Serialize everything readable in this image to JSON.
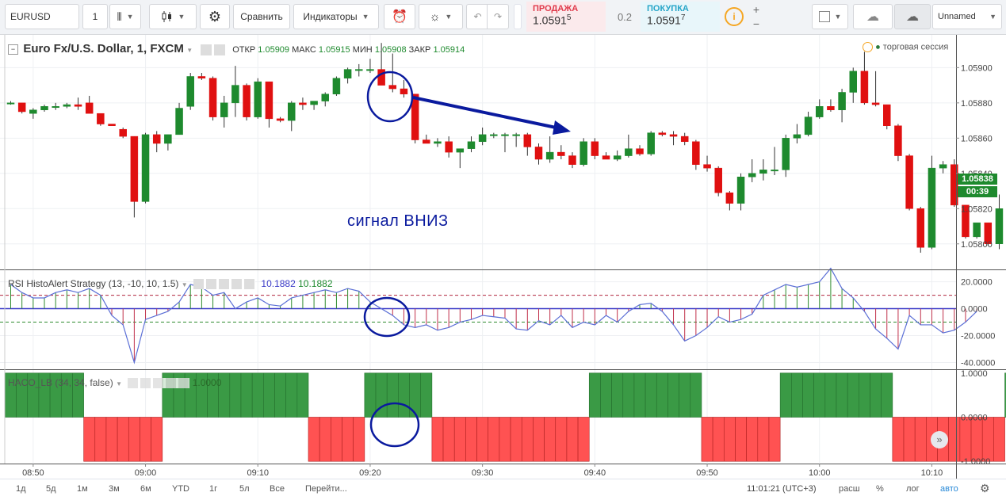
{
  "toolbar": {
    "symbol": "EURUSD",
    "interval": "1",
    "compare_label": "Сравнить",
    "indicators_label": "Индикаторы",
    "sell_label": "ПРОДАЖА",
    "sell_price": "1.0591",
    "sell_price_sup": "5",
    "spread": "0.2",
    "buy_label": "ПОКУПКА",
    "buy_price": "1.0591",
    "buy_price_sup": "7",
    "layout_name": "Unnamed",
    "colors": {
      "sell": "#e0394a",
      "buy": "#26a5c8"
    }
  },
  "main_pane": {
    "title": "Euro Fx/U.S. Dollar, 1, FXCM",
    "ohlc": [
      {
        "label": "ОТКР",
        "value": "1.05909"
      },
      {
        "label": "МАКС",
        "value": "1.05915"
      },
      {
        "label": "МИН",
        "value": "1.05908"
      },
      {
        "label": "ЗАКР",
        "value": "1.05914"
      }
    ],
    "session_label": "торговая сессия",
    "annotation": "сигнал ВНИЗ",
    "price_ticks": [
      "1.05900",
      "1.05880",
      "1.05860",
      "1.05840",
      "1.05820",
      "1.05800"
    ],
    "last_price": "1.05838",
    "countdown": "00:39",
    "colors": {
      "up": "#1e8a2e",
      "down": "#e01010",
      "arrow": "#0a1a9e"
    }
  },
  "rsi_pane": {
    "title": "RSI HistoAlert Strategy (13, -10, 10, 1.5)",
    "value1": "10.1882",
    "value2": "10.1882",
    "ticks": [
      "20.0000",
      "0.0000",
      "-20.0000",
      "-40.0000"
    ]
  },
  "haco_pane": {
    "title": "HACO_LB (34, 34, false)",
    "value": "1.0000",
    "ticks": [
      "1.0000",
      "0.0000",
      "-1.0000"
    ]
  },
  "time_axis": [
    "08:50",
    "09:00",
    "09:10",
    "09:20",
    "09:30",
    "09:40",
    "09:50",
    "10:00",
    "10:10"
  ],
  "bottom_bar": {
    "ranges": [
      "1д",
      "5д",
      "1м",
      "3м",
      "6м",
      "YTD",
      "1г",
      "5л",
      "Все",
      "Перейти..."
    ],
    "clock": "11:01:21 (UTC+3)",
    "options": [
      "расш",
      "%",
      "лог",
      "авто"
    ]
  },
  "chart_data": {
    "type": "candlestick",
    "x_unit": "1-minute bars, 08:48 to 10:12",
    "bars": [
      [
        1.0588,
        1.05881,
        1.05879,
        1.0588
      ],
      [
        1.0588,
        1.0588,
        1.05874,
        1.05875
      ],
      [
        1.05874,
        1.05877,
        1.05871,
        1.05876
      ],
      [
        1.05876,
        1.05879,
        1.05875,
        1.05878
      ],
      [
        1.05878,
        1.0588,
        1.05876,
        1.05878
      ],
      [
        1.05878,
        1.0588,
        1.05877,
        1.05879
      ],
      [
        1.05879,
        1.05883,
        1.05876,
        1.05878
      ],
      [
        1.0588,
        1.05884,
        1.05875,
        1.05874
      ],
      [
        1.05874,
        1.05874,
        1.05867,
        1.05868
      ],
      [
        1.05868,
        1.05868,
        1.05867,
        1.05867
      ],
      [
        1.05865,
        1.05866,
        1.0586,
        1.05861
      ],
      [
        1.05861,
        1.05861,
        1.05815,
        1.05824
      ],
      [
        1.05824,
        1.05863,
        1.05823,
        1.05862
      ],
      [
        1.05862,
        1.05864,
        1.05852,
        1.05857
      ],
      [
        1.05857,
        1.05862,
        1.05853,
        1.05862
      ],
      [
        1.05862,
        1.0588,
        1.05862,
        1.05877
      ],
      [
        1.05878,
        1.05897,
        1.05876,
        1.05895
      ],
      [
        1.05895,
        1.05897,
        1.05893,
        1.05894
      ],
      [
        1.05894,
        1.05895,
        1.0587,
        1.05872
      ],
      [
        1.05872,
        1.05884,
        1.05866,
        1.0588
      ],
      [
        1.0588,
        1.05901,
        1.05872,
        1.0589
      ],
      [
        1.0589,
        1.05891,
        1.0587,
        1.05872
      ],
      [
        1.05872,
        1.05894,
        1.05871,
        1.05892
      ],
      [
        1.05892,
        1.05892,
        1.05866,
        1.05871
      ],
      [
        1.05871,
        1.05872,
        1.05869,
        1.0587
      ],
      [
        1.0587,
        1.05881,
        1.05864,
        1.0588
      ],
      [
        1.0588,
        1.05883,
        1.05876,
        1.05879
      ],
      [
        1.05879,
        1.0588,
        1.05876,
        1.05881
      ],
      [
        1.05881,
        1.05886,
        1.05878,
        1.05885
      ],
      [
        1.05885,
        1.05895,
        1.05884,
        1.05894
      ],
      [
        1.05894,
        1.059,
        1.05891,
        1.05899
      ],
      [
        1.05899,
        1.05902,
        1.05895,
        1.05899
      ],
      [
        1.05899,
        1.05905,
        1.05897,
        1.05899
      ],
      [
        1.05899,
        1.05914,
        1.05892,
        1.0589
      ],
      [
        1.0589,
        1.05908,
        1.05886,
        1.05888
      ],
      [
        1.05888,
        1.05893,
        1.05883,
        1.05885
      ],
      [
        1.05885,
        1.05885,
        1.05857,
        1.05859
      ],
      [
        1.05859,
        1.05862,
        1.05857,
        1.05857
      ],
      [
        1.05857,
        1.0586,
        1.05855,
        1.05858
      ],
      [
        1.05858,
        1.05861,
        1.05849,
        1.05852
      ],
      [
        1.05852,
        1.05854,
        1.05843,
        1.05854
      ],
      [
        1.05854,
        1.05861,
        1.05852,
        1.05858
      ],
      [
        1.05858,
        1.05866,
        1.05856,
        1.05862
      ],
      [
        1.05862,
        1.05863,
        1.0586,
        1.05862
      ],
      [
        1.05862,
        1.05863,
        1.05852,
        1.05862
      ],
      [
        1.05862,
        1.05863,
        1.05855,
        1.05862
      ],
      [
        1.05862,
        1.05863,
        1.0585,
        1.05855
      ],
      [
        1.05855,
        1.05857,
        1.05845,
        1.05848
      ],
      [
        1.05848,
        1.05861,
        1.05846,
        1.05852
      ],
      [
        1.05852,
        1.05856,
        1.05848,
        1.0585
      ],
      [
        1.0585,
        1.05852,
        1.05843,
        1.05845
      ],
      [
        1.05845,
        1.0586,
        1.05844,
        1.05858
      ],
      [
        1.05858,
        1.0586,
        1.05848,
        1.0585
      ],
      [
        1.0585,
        1.05852,
        1.05848,
        1.05848
      ],
      [
        1.05848,
        1.05853,
        1.05847,
        1.0585
      ],
      [
        1.0585,
        1.05862,
        1.05849,
        1.05854
      ],
      [
        1.05854,
        1.05856,
        1.0585,
        1.05851
      ],
      [
        1.05851,
        1.05864,
        1.0585,
        1.05863
      ],
      [
        1.05863,
        1.05864,
        1.05861,
        1.05862
      ],
      [
        1.05862,
        1.05864,
        1.05856,
        1.05861
      ],
      [
        1.05861,
        1.05863,
        1.05856,
        1.05858
      ],
      [
        1.05858,
        1.05859,
        1.05842,
        1.05845
      ],
      [
        1.05845,
        1.0585,
        1.05841,
        1.05843
      ],
      [
        1.05843,
        1.05844,
        1.05827,
        1.05829
      ],
      [
        1.05829,
        1.0583,
        1.05819,
        1.05823
      ],
      [
        1.05823,
        1.0584,
        1.05819,
        1.05838
      ],
      [
        1.05838,
        1.05848,
        1.05835,
        1.0584
      ],
      [
        1.0584,
        1.05848,
        1.05836,
        1.05842
      ],
      [
        1.05842,
        1.05855,
        1.05839,
        1.05842
      ],
      [
        1.05842,
        1.05862,
        1.05838,
        1.0586
      ],
      [
        1.0586,
        1.05868,
        1.05857,
        1.05862
      ],
      [
        1.05862,
        1.05875,
        1.05861,
        1.05872
      ],
      [
        1.05872,
        1.05882,
        1.05871,
        1.05878
      ],
      [
        1.05878,
        1.05882,
        1.05875,
        1.05876
      ],
      [
        1.05876,
        1.05888,
        1.05869,
        1.05886
      ],
      [
        1.05886,
        1.059,
        1.0588,
        1.05898
      ],
      [
        1.05898,
        1.05909,
        1.05879,
        1.0588
      ],
      [
        1.0588,
        1.05898,
        1.05878,
        1.05879
      ],
      [
        1.05879,
        1.05879,
        1.05865,
        1.05867
      ],
      [
        1.05867,
        1.05868,
        1.05847,
        1.0585
      ],
      [
        1.0585,
        1.05851,
        1.05819,
        1.0582
      ],
      [
        1.0582,
        1.05821,
        1.05795,
        1.05798
      ],
      [
        1.05798,
        1.0585,
        1.05797,
        1.05843
      ],
      [
        1.05843,
        1.05847,
        1.0584,
        1.05845
      ],
      [
        1.05845,
        1.05848,
        1.05821,
        1.05822
      ],
      [
        1.05822,
        1.05822,
        1.05803,
        1.05804
      ],
      [
        1.05804,
        1.05812,
        1.05803,
        1.05812
      ],
      [
        1.05812,
        1.05812,
        1.05799,
        1.058
      ],
      [
        1.058,
        1.05828,
        1.05797,
        1.0582
      ],
      [
        1.0582,
        1.05842,
        1.05819,
        1.05838
      ]
    ],
    "rsi_values": [
      18,
      12,
      8,
      8,
      12,
      14,
      12,
      15,
      10,
      -5,
      -12,
      -40,
      -8,
      -5,
      -2,
      5,
      18,
      16,
      10,
      12,
      0,
      5,
      8,
      3,
      2,
      8,
      10,
      12,
      14,
      12,
      15,
      13,
      5,
      0,
      -5,
      -12,
      -14,
      -12,
      -16,
      -14,
      -10,
      -8,
      -5,
      -6,
      -7,
      -15,
      -16,
      -9,
      -12,
      -5,
      -14,
      -10,
      -12,
      -5,
      -10,
      -2,
      3,
      4,
      -2,
      -12,
      -24,
      -20,
      -14,
      -6,
      -10,
      -8,
      -4,
      10,
      14,
      18,
      16,
      18,
      20,
      30,
      15,
      8,
      -2,
      -15,
      -22,
      -30,
      -5,
      -12,
      -12,
      -18,
      -16,
      -10,
      -2
    ],
    "rsi_ylim": [
      -40,
      20
    ],
    "haco_values": [
      1,
      1,
      1,
      1,
      1,
      1,
      1,
      -1,
      -1,
      -1,
      -1,
      -1,
      -1,
      -1,
      1,
      1,
      1,
      1,
      1,
      1,
      1,
      1,
      1,
      1,
      1,
      1,
      1,
      -1,
      -1,
      -1,
      -1,
      -1,
      1,
      1,
      1,
      1,
      1,
      1,
      -1,
      -1,
      -1,
      -1,
      -1,
      -1,
      -1,
      -1,
      -1,
      -1,
      -1,
      -1,
      -1,
      -1,
      1,
      1,
      1,
      1,
      1,
      1,
      1,
      1,
      1,
      1,
      -1,
      -1,
      -1,
      -1,
      -1,
      -1,
      -1,
      1,
      1,
      1,
      1,
      1,
      1,
      1,
      1,
      1,
      1,
      -1,
      -1,
      -1,
      -1,
      -1,
      -1,
      -1,
      -1,
      -1,
      -1,
      1
    ],
    "haco_ylim": [
      -1,
      1
    ]
  }
}
